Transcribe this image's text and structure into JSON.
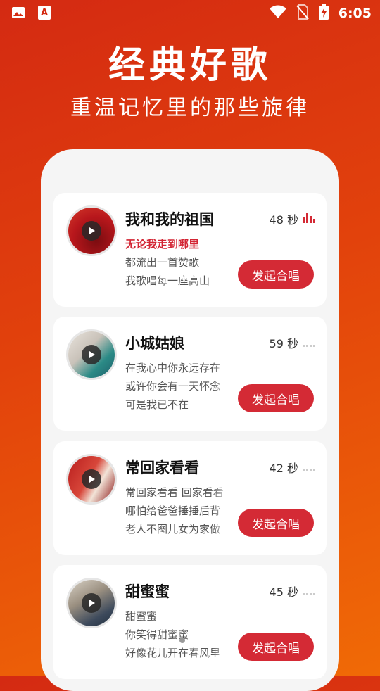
{
  "status_bar": {
    "time": "6:05",
    "icons": [
      "image-icon",
      "app-a-icon",
      "wifi-icon",
      "no-sim-icon",
      "battery-charging-icon"
    ]
  },
  "hero": {
    "title": "经典好歌",
    "subtitle": "重温记忆里的那些旋律"
  },
  "songs": [
    {
      "title": "我和我的祖国",
      "duration": "48 秒",
      "lyrics": [
        "无论我走到哪里",
        "都流出一首赞歌",
        "我歌唱每一座高山"
      ],
      "active_lyric": 0,
      "playing": true,
      "button": "发起合唱"
    },
    {
      "title": "小城姑娘",
      "duration": "59 秒",
      "lyrics": [
        "在我心中你永远存在",
        "或许你会有一天怀念",
        "可是我已不在"
      ],
      "active_lyric": -1,
      "playing": false,
      "button": "发起合唱"
    },
    {
      "title": "常回家看看",
      "duration": "42 秒",
      "lyrics": [
        "常回家看看 回家看看",
        "哪怕给爸爸捶捶后背",
        "老人不图儿女为家做"
      ],
      "active_lyric": -1,
      "playing": false,
      "button": "发起合唱"
    },
    {
      "title": "甜蜜蜜",
      "duration": "45 秒",
      "lyrics": [
        "甜蜜蜜",
        "你笑得甜蜜蜜",
        "好像花儿开在春风里"
      ],
      "active_lyric": -1,
      "playing": false,
      "button": "发起合唱"
    }
  ],
  "colors": {
    "accent": "#d42a35",
    "background_gradient_start": "#d42a12",
    "background_gradient_end": "#f06a06"
  }
}
